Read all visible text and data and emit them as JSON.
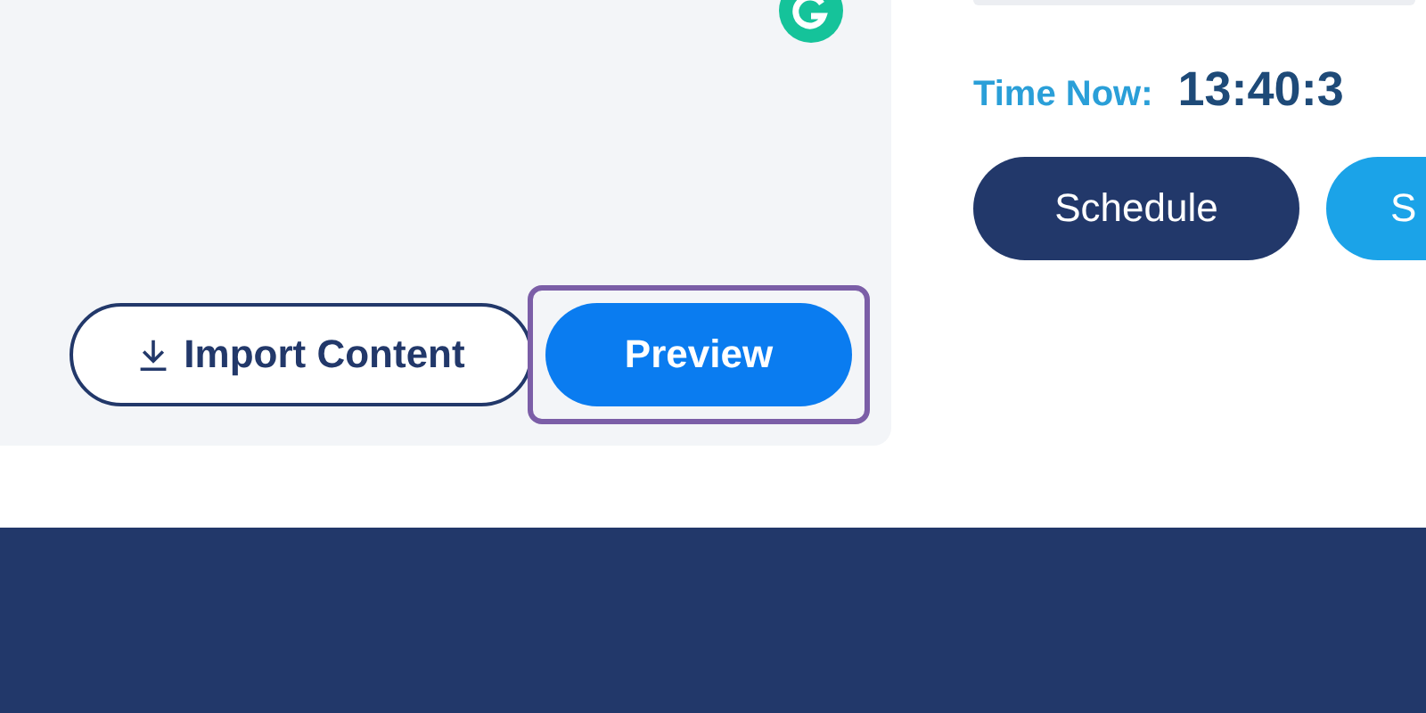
{
  "editor": {
    "import_button": {
      "label": "Import Content"
    },
    "preview_button": {
      "label": "Preview",
      "highlighted": true
    }
  },
  "schedule_panel": {
    "time_label": "Time Now:",
    "time_value": "13:40:3",
    "buttons": [
      {
        "label": "Schedule",
        "kind": "dark"
      },
      {
        "label": "S",
        "kind": "light"
      }
    ]
  }
}
